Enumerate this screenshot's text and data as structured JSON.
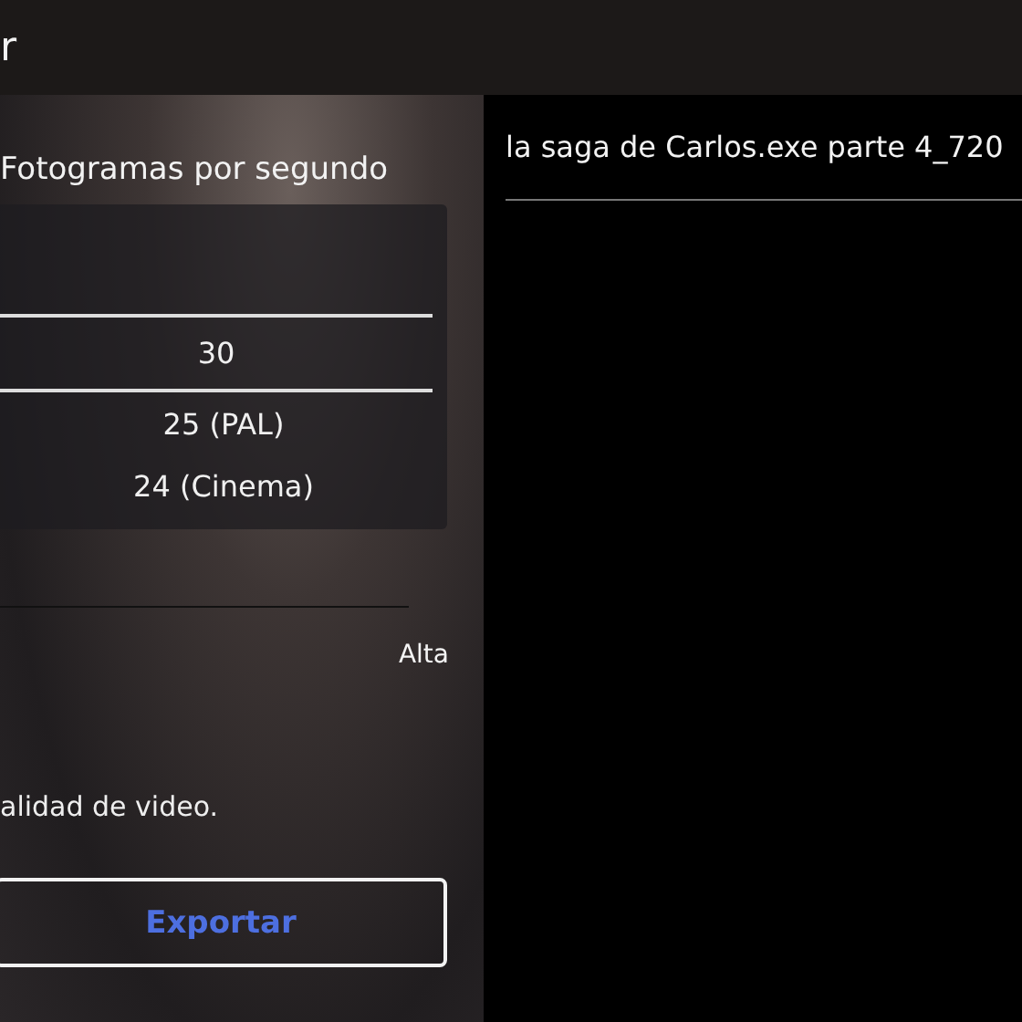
{
  "header": {
    "title": "r"
  },
  "settings": {
    "fps_label": "Fotogramas por segundo",
    "fps_options": [
      {
        "label": "30",
        "selected": true
      },
      {
        "label": "25 (PAL)",
        "selected": false
      },
      {
        "label": "24 (Cinema)",
        "selected": false
      }
    ],
    "quality_label": "Alta",
    "note": "alidad de video.",
    "export_button": "Exportar"
  },
  "preview": {
    "file_name": "la saga de Carlos.exe parte 4_720"
  }
}
